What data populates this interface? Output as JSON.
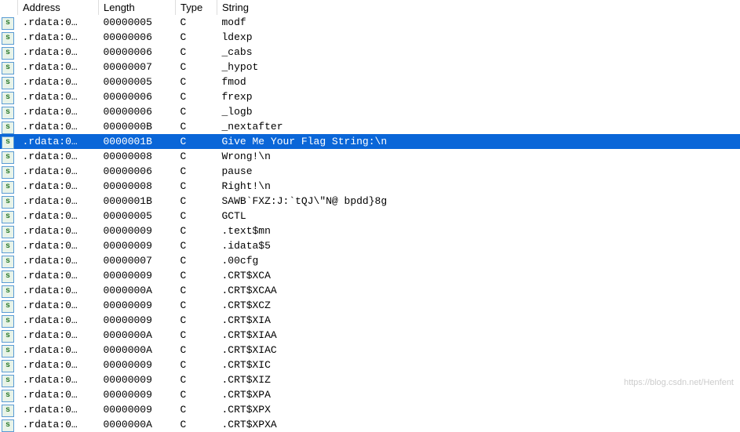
{
  "columns": {
    "address": "Address",
    "length": "Length",
    "type": "Type",
    "string": "String"
  },
  "rows": [
    {
      "address": ".rdata:0…",
      "length": "00000005",
      "type": "C",
      "string": "modf",
      "selected": false
    },
    {
      "address": ".rdata:0…",
      "length": "00000006",
      "type": "C",
      "string": "ldexp",
      "selected": false
    },
    {
      "address": ".rdata:0…",
      "length": "00000006",
      "type": "C",
      "string": "_cabs",
      "selected": false
    },
    {
      "address": ".rdata:0…",
      "length": "00000007",
      "type": "C",
      "string": "_hypot",
      "selected": false
    },
    {
      "address": ".rdata:0…",
      "length": "00000005",
      "type": "C",
      "string": "fmod",
      "selected": false
    },
    {
      "address": ".rdata:0…",
      "length": "00000006",
      "type": "C",
      "string": "frexp",
      "selected": false
    },
    {
      "address": ".rdata:0…",
      "length": "00000006",
      "type": "C",
      "string": "_logb",
      "selected": false
    },
    {
      "address": ".rdata:0…",
      "length": "0000000B",
      "type": "C",
      "string": "_nextafter",
      "selected": false
    },
    {
      "address": ".rdata:0…",
      "length": "0000001B",
      "type": "C",
      "string": "Give Me Your Flag String:\\n",
      "selected": true
    },
    {
      "address": ".rdata:0…",
      "length": "00000008",
      "type": "C",
      "string": "Wrong!\\n",
      "selected": false
    },
    {
      "address": ".rdata:0…",
      "length": "00000006",
      "type": "C",
      "string": "pause",
      "selected": false
    },
    {
      "address": ".rdata:0…",
      "length": "00000008",
      "type": "C",
      "string": "Right!\\n",
      "selected": false
    },
    {
      "address": ".rdata:0…",
      "length": "0000001B",
      "type": "C",
      "string": "SAWB`FXZ:J:`tQJ\\\"N@ bpdd}8g",
      "selected": false
    },
    {
      "address": ".rdata:0…",
      "length": "00000005",
      "type": "C",
      "string": "GCTL",
      "selected": false
    },
    {
      "address": ".rdata:0…",
      "length": "00000009",
      "type": "C",
      "string": ".text$mn",
      "selected": false
    },
    {
      "address": ".rdata:0…",
      "length": "00000009",
      "type": "C",
      "string": ".idata$5",
      "selected": false
    },
    {
      "address": ".rdata:0…",
      "length": "00000007",
      "type": "C",
      "string": ".00cfg",
      "selected": false
    },
    {
      "address": ".rdata:0…",
      "length": "00000009",
      "type": "C",
      "string": ".CRT$XCA",
      "selected": false
    },
    {
      "address": ".rdata:0…",
      "length": "0000000A",
      "type": "C",
      "string": ".CRT$XCAA",
      "selected": false
    },
    {
      "address": ".rdata:0…",
      "length": "00000009",
      "type": "C",
      "string": ".CRT$XCZ",
      "selected": false
    },
    {
      "address": ".rdata:0…",
      "length": "00000009",
      "type": "C",
      "string": ".CRT$XIA",
      "selected": false
    },
    {
      "address": ".rdata:0…",
      "length": "0000000A",
      "type": "C",
      "string": ".CRT$XIAA",
      "selected": false
    },
    {
      "address": ".rdata:0…",
      "length": "0000000A",
      "type": "C",
      "string": ".CRT$XIAC",
      "selected": false
    },
    {
      "address": ".rdata:0…",
      "length": "00000009",
      "type": "C",
      "string": ".CRT$XIC",
      "selected": false
    },
    {
      "address": ".rdata:0…",
      "length": "00000009",
      "type": "C",
      "string": ".CRT$XIZ",
      "selected": false
    },
    {
      "address": ".rdata:0…",
      "length": "00000009",
      "type": "C",
      "string": ".CRT$XPA",
      "selected": false
    },
    {
      "address": ".rdata:0…",
      "length": "00000009",
      "type": "C",
      "string": ".CRT$XPX",
      "selected": false
    },
    {
      "address": ".rdata:0…",
      "length": "0000000A",
      "type": "C",
      "string": ".CRT$XPXA",
      "selected": false
    }
  ],
  "icon_glyph": "s",
  "watermark": "https://blog.csdn.net/Henfent"
}
